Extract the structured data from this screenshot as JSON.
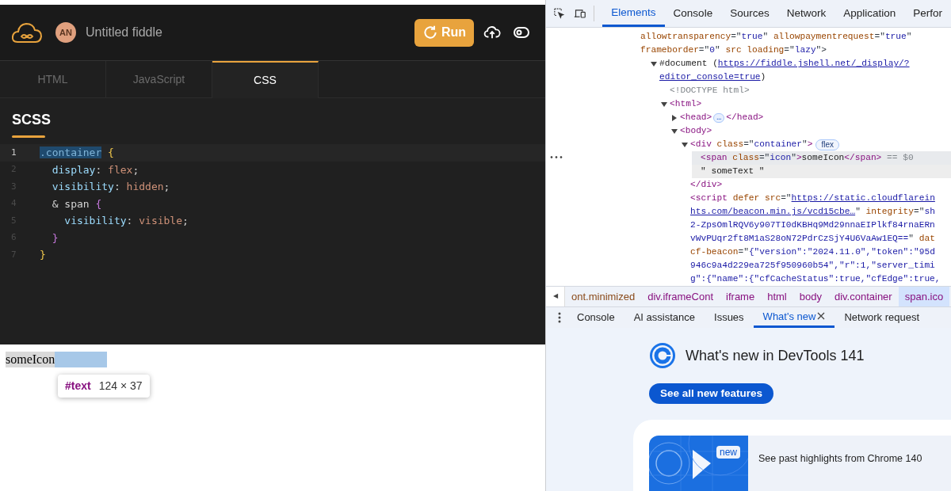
{
  "fiddle": {
    "avatar": "AN",
    "title": "Untitled fiddle",
    "run_button": "Run",
    "tabs": [
      {
        "label": "HTML",
        "selected": false
      },
      {
        "label": "JavaScript",
        "selected": false
      },
      {
        "label": "CSS",
        "selected": true
      }
    ],
    "editor_title": "SCSS",
    "code_lines": [
      {
        "number": "1",
        "active": true,
        "tokens": [
          {
            "text": ".container",
            "kind": "selector",
            "selected": true
          },
          {
            "text": " {",
            "kind": "brace1",
            "selected": false
          }
        ]
      },
      {
        "number": "2",
        "active": false,
        "tokens": [
          {
            "text": "  display",
            "kind": "property",
            "selected": false
          },
          {
            "text": ": ",
            "kind": "plain",
            "selected": false
          },
          {
            "text": "flex",
            "kind": "value",
            "selected": false
          },
          {
            "text": ";",
            "kind": "plain",
            "selected": false
          }
        ]
      },
      {
        "number": "3",
        "active": false,
        "tokens": [
          {
            "text": "  visibility",
            "kind": "property",
            "selected": false
          },
          {
            "text": ": ",
            "kind": "plain",
            "selected": false
          },
          {
            "text": "hidden",
            "kind": "value",
            "selected": false
          },
          {
            "text": ";",
            "kind": "plain",
            "selected": false
          }
        ]
      },
      {
        "number": "4",
        "active": false,
        "tokens": [
          {
            "text": "  & span ",
            "kind": "plain",
            "selected": false
          },
          {
            "text": "{",
            "kind": "brace2",
            "selected": false
          }
        ]
      },
      {
        "number": "5",
        "active": false,
        "tokens": [
          {
            "text": "    visibility",
            "kind": "property",
            "selected": false
          },
          {
            "text": ": ",
            "kind": "plain",
            "selected": false
          },
          {
            "text": "visible",
            "kind": "value",
            "selected": false
          },
          {
            "text": ";",
            "kind": "plain",
            "selected": false
          }
        ]
      },
      {
        "number": "6",
        "active": false,
        "tokens": [
          {
            "text": "  }",
            "kind": "brace2",
            "selected": false
          }
        ]
      },
      {
        "number": "7",
        "active": false,
        "tokens": [
          {
            "text": "}",
            "kind": "brace1",
            "selected": false
          }
        ]
      }
    ],
    "output": {
      "icon_text": "someIcon",
      "tooltip_node": "#text",
      "tooltip_size": "124 × 37"
    }
  },
  "devtools": {
    "tabs": [
      {
        "label": "Elements",
        "selected": true
      },
      {
        "label": "Console",
        "selected": false
      },
      {
        "label": "Sources",
        "selected": false
      },
      {
        "label": "Network",
        "selected": false
      },
      {
        "label": "Application",
        "selected": false
      },
      {
        "label": "Perfor",
        "selected": false
      }
    ],
    "tree": [
      {
        "kind": "plain",
        "selected": false,
        "hovered": false,
        "lines": [
          [
            {
              "kind": "attr",
              "text": "allowtransparency"
            },
            {
              "kind": "punct",
              "text": "=\""
            },
            {
              "kind": "value",
              "text": "true"
            },
            {
              "kind": "punct",
              "text": "\" "
            },
            {
              "kind": "attr",
              "text": "allowpaymentrequest"
            },
            {
              "kind": "punct",
              "text": "=\""
            },
            {
              "kind": "value",
              "text": "true"
            },
            {
              "kind": "punct",
              "text": "\""
            }
          ],
          [
            {
              "kind": "attr",
              "text": "frameborder"
            },
            {
              "kind": "punct",
              "text": "=\""
            },
            {
              "kind": "value",
              "text": "0"
            },
            {
              "kind": "punct",
              "text": "\" "
            },
            {
              "kind": "attr",
              "text": "src loading"
            },
            {
              "kind": "punct",
              "text": "=\""
            },
            {
              "kind": "value",
              "text": "lazy"
            },
            {
              "kind": "punct",
              "text": "\">"
            }
          ]
        ],
        "children": [
          {
            "kind": "expanded",
            "selected": false,
            "hovered": false,
            "lines": [
              [
                {
                  "kind": "text",
                  "text": "#document ("
                },
                {
                  "kind": "link",
                  "text": "https://fiddle.jshell.net/_display/?"
                }
              ],
              [
                {
                  "kind": "link",
                  "text": "editor_console=true"
                },
                {
                  "kind": "text",
                  "text": ")"
                }
              ]
            ],
            "children": [
              {
                "kind": "leaf",
                "selected": false,
                "hovered": false,
                "lines": [
                  [
                    {
                      "kind": "comment",
                      "text": "<!DOCTYPE html>"
                    }
                  ]
                ]
              },
              {
                "kind": "expanded",
                "selected": false,
                "hovered": false,
                "lines": [
                  [
                    {
                      "kind": "tag",
                      "text": "<html>"
                    }
                  ]
                ],
                "children": [
                  {
                    "kind": "collapsed",
                    "selected": false,
                    "hovered": false,
                    "lines": [
                      [
                        {
                          "kind": "tag",
                          "text": "<head>"
                        },
                        {
                          "kind": "ellipsis",
                          "text": "…"
                        },
                        {
                          "kind": "tag",
                          "text": "</head>"
                        }
                      ]
                    ]
                  },
                  {
                    "kind": "expanded",
                    "selected": false,
                    "hovered": false,
                    "lines": [
                      [
                        {
                          "kind": "tag",
                          "text": "<body>"
                        }
                      ]
                    ],
                    "children": [
                      {
                        "kind": "expanded",
                        "selected": false,
                        "hovered": false,
                        "lines": [
                          [
                            {
                              "kind": "tag",
                              "text": "<div "
                            },
                            {
                              "kind": "attr",
                              "text": "class"
                            },
                            {
                              "kind": "punct",
                              "text": "=\""
                            },
                            {
                              "kind": "value",
                              "text": "container"
                            },
                            {
                              "kind": "punct",
                              "text": "\""
                            },
                            {
                              "kind": "tag",
                              "text": ">"
                            },
                            {
                              "kind": "badge",
                              "text": "flex"
                            }
                          ]
                        ],
                        "children": [
                          {
                            "kind": "leaf",
                            "selected": true,
                            "hovered": false,
                            "options": "•••",
                            "lines": [
                              [
                                {
                                  "kind": "tag",
                                  "text": "<span "
                                },
                                {
                                  "kind": "attr",
                                  "text": "class"
                                },
                                {
                                  "kind": "punct",
                                  "text": "=\""
                                },
                                {
                                  "kind": "value",
                                  "text": "icon"
                                },
                                {
                                  "kind": "punct",
                                  "text": "\""
                                },
                                {
                                  "kind": "tag",
                                  "text": ">"
                                },
                                {
                                  "kind": "text",
                                  "text": "someIcon"
                                },
                                {
                                  "kind": "tag",
                                  "text": "</span>"
                                },
                                {
                                  "kind": "comment",
                                  "text": " == $0"
                                }
                              ]
                            ]
                          },
                          {
                            "kind": "leaf",
                            "selected": false,
                            "hovered": true,
                            "lines": [
                              [
                                {
                                  "kind": "text",
                                  "text": "\" someText \""
                                }
                              ]
                            ]
                          }
                        ],
                        "closing": [
                          {
                            "kind": "tag",
                            "text": "</div>"
                          }
                        ]
                      },
                      {
                        "kind": "leaf",
                        "selected": false,
                        "hovered": false,
                        "lines": [
                          [
                            {
                              "kind": "tag",
                              "text": "<script "
                            },
                            {
                              "kind": "attr",
                              "text": "defer src"
                            },
                            {
                              "kind": "punct",
                              "text": "=\""
                            },
                            {
                              "kind": "link",
                              "text": "https://static.cloudflarein"
                            }
                          ],
                          [
                            {
                              "kind": "link",
                              "text": "hts.com/beacon.min.js/vcd15cbe…"
                            },
                            {
                              "kind": "punct",
                              "text": "\" "
                            },
                            {
                              "kind": "attr",
                              "text": "integrity"
                            },
                            {
                              "kind": "punct",
                              "text": "=\""
                            },
                            {
                              "kind": "value",
                              "text": "sh"
                            }
                          ],
                          [
                            {
                              "kind": "value",
                              "text": "2-ZpsOmlRQV6y907TI0dKBHq9Md29nnaEIPlkf84rnaERn"
                            }
                          ],
                          [
                            {
                              "kind": "value",
                              "text": "vWvPUqr2ft8M1aS28oN72PdrCzSjY4U6VaAw1EQ=="
                            },
                            {
                              "kind": "punct",
                              "text": "\" "
                            },
                            {
                              "kind": "attr",
                              "text": "dat"
                            }
                          ],
                          [
                            {
                              "kind": "attr",
                              "text": "cf-beacon"
                            },
                            {
                              "kind": "punct",
                              "text": "=\""
                            },
                            {
                              "kind": "value",
                              "text": "{\"version\":\"2024.11.0\",\"token\":\"95d"
                            }
                          ],
                          [
                            {
                              "kind": "value",
                              "text": "946c9a4d229ea725f950960b54\",\"r\":1,\"server_timi"
                            }
                          ],
                          [
                            {
                              "kind": "value",
                              "text": "g\":{\"name\":{\"cfCacheStatus\":true,\"cfEdge\":true,"
                            }
                          ]
                        ]
                      }
                    ]
                  }
                ]
              }
            ]
          }
        ]
      }
    ],
    "scroll_left": "◀",
    "breadcrumbs": [
      {
        "label": "ont.minimized",
        "selected": false
      },
      {
        "label": "div.iframeCont",
        "selected": false
      },
      {
        "label": "iframe",
        "selected": false
      },
      {
        "label": "html",
        "selected": false
      },
      {
        "label": "body",
        "selected": false
      },
      {
        "label": "div.container",
        "selected": false
      },
      {
        "label": "span.ico",
        "selected": true
      }
    ],
    "drawer_tabs": [
      {
        "label": "Console",
        "selected": false,
        "closable": false
      },
      {
        "label": "AI assistance",
        "selected": false,
        "closable": false
      },
      {
        "label": "Issues",
        "selected": false,
        "closable": false
      },
      {
        "label": "What's new",
        "selected": true,
        "closable": true
      },
      {
        "label": "Network request",
        "selected": false,
        "closable": false
      }
    ],
    "whats_new": {
      "heading": "What's new in DevTools 141",
      "button": "See all new features",
      "card": {
        "badge": "new",
        "text": "See past highlights from Chrome 140"
      }
    }
  }
}
